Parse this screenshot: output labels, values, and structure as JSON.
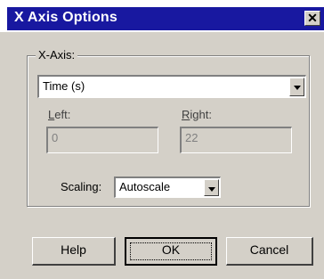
{
  "dialog": {
    "title": "X Axis Options",
    "close_glyph": "✕"
  },
  "xaxis": {
    "group_label": "X-Axis:",
    "selected": "Time (s)",
    "left_label_first": "L",
    "left_label_rest": "eft:",
    "left_value": "0",
    "right_label_first": "R",
    "right_label_rest": "ight:",
    "right_value": "22",
    "scaling_label": "Scaling:",
    "scaling_selected": "Autoscale"
  },
  "buttons": {
    "help": "Help",
    "ok": "OK",
    "cancel": "Cancel"
  },
  "icons": {
    "close": "close-icon",
    "dropdown": "chevron-down-icon"
  }
}
